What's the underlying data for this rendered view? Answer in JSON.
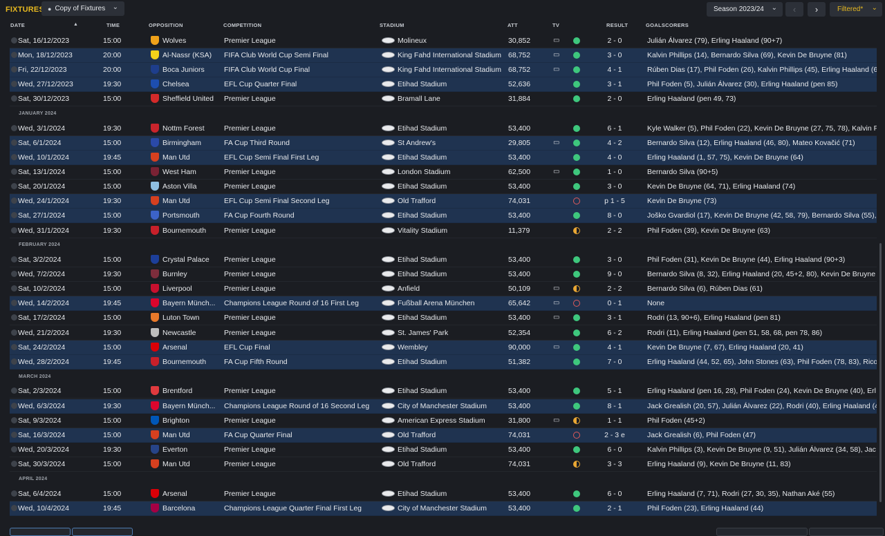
{
  "header": {
    "title": "FIXTURES",
    "view_select": "Copy of Fixtures",
    "season": "Season 2023/24",
    "filter": "Filtered*"
  },
  "columns": {
    "date": "DATE",
    "time": "TIME",
    "opposition": "OPPOSITION",
    "competition": "COMPETITION",
    "stadium": "STADIUM",
    "att": "ATT",
    "tv": "TV",
    "result": "RESULT",
    "goalscorers": "GOALSCORERS"
  },
  "months": {
    "jan": "JANUARY 2024",
    "feb": "FEBRUARY 2024",
    "mar": "MARCH 2024",
    "apr": "APRIL 2024"
  },
  "colors": {
    "accent": "#e6b820",
    "row_highlight": "#1f3350",
    "win": "#3ec77d",
    "draw": "#e9a734",
    "loss": "#e05b5b"
  },
  "fixtures": [
    {
      "date": "Sat, 16/12/2023",
      "time": "15:00",
      "opp": "Wolves",
      "comp": "Premier League",
      "stadium": "Molineux",
      "att": "30,852",
      "tv": true,
      "outcome": "win",
      "result": "2 - 0",
      "scorers": "Julián Álvarez (79), Erling Haaland (90+7)",
      "hl": false,
      "crest": "#f0a21a"
    },
    {
      "date": "Mon, 18/12/2023",
      "time": "20:00",
      "opp": "Al-Nassr (KSA)",
      "comp": "FIFA Club World Cup Semi Final",
      "stadium": "King Fahd International Stadium",
      "att": "68,752",
      "tv": true,
      "outcome": "win",
      "result": "3 - 0",
      "scorers": "Kalvin Phillips (14), Bernardo Silva (69), Kevin De Bruyne (81)",
      "hl": true,
      "crest": "#f2d21a"
    },
    {
      "date": "Fri, 22/12/2023",
      "time": "20:00",
      "opp": "Boca Juniors",
      "comp": "FIFA Club World Cup Final",
      "stadium": "King Fahd International Stadium",
      "att": "68,752",
      "tv": true,
      "outcome": "win",
      "result": "4 - 1",
      "scorers": "Rúben Dias (17), Phil Foden (26), Kalvin Phillips (45), Erling Haaland (6",
      "hl": true,
      "crest": "#1e3e8c"
    },
    {
      "date": "Wed, 27/12/2023",
      "time": "19:30",
      "opp": "Chelsea",
      "comp": "EFL Cup Quarter Final",
      "stadium": "Etihad Stadium",
      "att": "52,636",
      "tv": false,
      "outcome": "win",
      "result": "3 - 1",
      "scorers": "Phil Foden (5), Julián Álvarez (30), Erling Haaland (pen 85)",
      "hl": true,
      "crest": "#1d4eb0"
    },
    {
      "date": "Sat, 30/12/2023",
      "time": "15:00",
      "opp": "Sheffield United",
      "comp": "Premier League",
      "stadium": "Bramall Lane",
      "att": "31,884",
      "tv": false,
      "outcome": "win",
      "result": "2 - 0",
      "scorers": "Erling Haaland (pen 49, 73)",
      "hl": false,
      "crest": "#d32a2a"
    },
    {
      "date": "Wed, 3/1/2024",
      "time": "19:30",
      "opp": "Nottm Forest",
      "comp": "Premier League",
      "stadium": "Etihad Stadium",
      "att": "53,400",
      "tv": false,
      "outcome": "win",
      "result": "6 - 1",
      "scorers": "Kyle Walker (5), Phil Foden (22), Kevin De Bruyne (27, 75, 78), Kalvin P",
      "hl": false,
      "crest": "#c9242c"
    },
    {
      "date": "Sat, 6/1/2024",
      "time": "15:00",
      "opp": "Birmingham",
      "comp": "FA Cup Third Round",
      "stadium": "St Andrew's",
      "att": "29,805",
      "tv": true,
      "outcome": "win",
      "result": "4 - 2",
      "scorers": "Bernardo Silva (12), Erling Haaland (46, 80), Mateo Kovačić (71)",
      "hl": true,
      "crest": "#2a49a8"
    },
    {
      "date": "Wed, 10/1/2024",
      "time": "19:45",
      "opp": "Man Utd",
      "comp": "EFL Cup Semi Final First Leg",
      "stadium": "Etihad Stadium",
      "att": "53,400",
      "tv": false,
      "outcome": "win",
      "result": "4 - 0",
      "scorers": "Erling Haaland (1, 57, 75), Kevin De Bruyne (64)",
      "hl": true,
      "crest": "#d6401f"
    },
    {
      "date": "Sat, 13/1/2024",
      "time": "15:00",
      "opp": "West Ham",
      "comp": "Premier League",
      "stadium": "London Stadium",
      "att": "62,500",
      "tv": true,
      "outcome": "win",
      "result": "1 - 0",
      "scorers": "Bernardo Silva (90+5)",
      "hl": false,
      "crest": "#7a2234"
    },
    {
      "date": "Sat, 20/1/2024",
      "time": "15:00",
      "opp": "Aston Villa",
      "comp": "Premier League",
      "stadium": "Etihad Stadium",
      "att": "53,400",
      "tv": false,
      "outcome": "win",
      "result": "3 - 0",
      "scorers": "Kevin De Bruyne (64, 71), Erling Haaland (74)",
      "hl": false,
      "crest": "#8fbfe2"
    },
    {
      "date": "Wed, 24/1/2024",
      "time": "19:30",
      "opp": "Man Utd",
      "comp": "EFL Cup Semi Final Second Leg",
      "stadium": "Old Trafford",
      "att": "74,031",
      "tv": false,
      "outcome": "loss",
      "result": "p 1 - 5",
      "scorers": "Kevin De Bruyne (73)",
      "hl": true,
      "crest": "#d6401f"
    },
    {
      "date": "Sat, 27/1/2024",
      "time": "15:00",
      "opp": "Portsmouth",
      "comp": "FA Cup Fourth Round",
      "stadium": "Etihad Stadium",
      "att": "53,400",
      "tv": false,
      "outcome": "win",
      "result": "8 - 0",
      "scorers": "Joško Gvardiol (17), Kevin De Bruyne (42, 58, 79), Bernardo Silva (55),",
      "hl": true,
      "crest": "#3c63c8"
    },
    {
      "date": "Wed, 31/1/2024",
      "time": "19:30",
      "opp": "Bournemouth",
      "comp": "Premier League",
      "stadium": "Vitality Stadium",
      "att": "11,379",
      "tv": false,
      "outcome": "draw",
      "result": "2 - 2",
      "scorers": "Phil Foden (39), Kevin De Bruyne (63)",
      "hl": false,
      "crest": "#c8202a"
    },
    {
      "date": "Sat, 3/2/2024",
      "time": "15:00",
      "opp": "Crystal Palace",
      "comp": "Premier League",
      "stadium": "Etihad Stadium",
      "att": "53,400",
      "tv": false,
      "outcome": "win",
      "result": "3 - 0",
      "scorers": "Phil Foden (31), Kevin De Bruyne (44), Erling Haaland (90+3)",
      "hl": false,
      "crest": "#1d3f9a"
    },
    {
      "date": "Wed, 7/2/2024",
      "time": "19:30",
      "opp": "Burnley",
      "comp": "Premier League",
      "stadium": "Etihad Stadium",
      "att": "53,400",
      "tv": false,
      "outcome": "win",
      "result": "9 - 0",
      "scorers": "Bernardo Silva (8, 32), Erling Haaland (20, 45+2, 80), Kevin De Bruyne",
      "hl": false,
      "crest": "#7e2d3c"
    },
    {
      "date": "Sat, 10/2/2024",
      "time": "15:00",
      "opp": "Liverpool",
      "comp": "Premier League",
      "stadium": "Anfield",
      "att": "50,109",
      "tv": true,
      "outcome": "draw",
      "result": "2 - 2",
      "scorers": "Bernardo Silva (6), Rúben Dias (61)",
      "hl": false,
      "crest": "#c8102e"
    },
    {
      "date": "Wed, 14/2/2024",
      "time": "19:45",
      "opp": "Bayern Münch...",
      "comp": "Champions League Round of 16  First Leg",
      "stadium": "Fußball Arena München",
      "att": "65,642",
      "tv": true,
      "outcome": "loss",
      "result": "0 - 1",
      "scorers": "None",
      "hl": true,
      "crest": "#dc052d"
    },
    {
      "date": "Sat, 17/2/2024",
      "time": "15:00",
      "opp": "Luton Town",
      "comp": "Premier League",
      "stadium": "Etihad Stadium",
      "att": "53,400",
      "tv": true,
      "outcome": "win",
      "result": "3 - 1",
      "scorers": "Rodri (13, 90+6), Erling Haaland (pen 81)",
      "hl": false,
      "crest": "#e8792a"
    },
    {
      "date": "Wed, 21/2/2024",
      "time": "19:30",
      "opp": "Newcastle",
      "comp": "Premier League",
      "stadium": "St. James' Park",
      "att": "52,354",
      "tv": false,
      "outcome": "win",
      "result": "6 - 2",
      "scorers": "Rodri (11), Erling Haaland (pen 51, 58, 68, pen 78, 86)",
      "hl": false,
      "crest": "#bdbdbd"
    },
    {
      "date": "Sat, 24/2/2024",
      "time": "15:00",
      "opp": "Arsenal",
      "comp": "EFL Cup Final",
      "stadium": "Wembley",
      "att": "90,000",
      "tv": true,
      "outcome": "win",
      "result": "4 - 1",
      "scorers": "Kevin De Bruyne (7, 67), Erling Haaland (20, 41)",
      "hl": true,
      "crest": "#db0007"
    },
    {
      "date": "Wed, 28/2/2024",
      "time": "19:45",
      "opp": "Bournemouth",
      "comp": "FA Cup Fifth Round",
      "stadium": "Etihad Stadium",
      "att": "51,382",
      "tv": false,
      "outcome": "win",
      "result": "7 - 0",
      "scorers": "Erling Haaland (44, 52, 65), John Stones (63), Phil Foden (78, 83), Rico",
      "hl": true,
      "crest": "#c8202a"
    },
    {
      "date": "Sat, 2/3/2024",
      "time": "15:00",
      "opp": "Brentford",
      "comp": "Premier League",
      "stadium": "Etihad Stadium",
      "att": "53,400",
      "tv": false,
      "outcome": "win",
      "result": "5 - 1",
      "scorers": "Erling Haaland (pen 16, 28), Phil Foden (24), Kevin De Bruyne (40), Erl",
      "hl": false,
      "crest": "#e03a3e"
    },
    {
      "date": "Wed, 6/3/2024",
      "time": "19:30",
      "opp": "Bayern Münch...",
      "comp": "Champions League Round of 16  Second Leg",
      "stadium": "City of Manchester Stadium",
      "att": "53,400",
      "tv": false,
      "outcome": "win",
      "result": "8 - 1",
      "scorers": "Jack Grealish (20, 57), Julián Álvarez (22), Rodri (40), Erling Haaland (4",
      "hl": true,
      "crest": "#dc052d"
    },
    {
      "date": "Sat, 9/3/2024",
      "time": "15:00",
      "opp": "Brighton",
      "comp": "Premier League",
      "stadium": "American Express Stadium",
      "att": "31,800",
      "tv": true,
      "outcome": "draw",
      "result": "1 - 1",
      "scorers": "Phil Foden (45+2)",
      "hl": false,
      "crest": "#0057b8"
    },
    {
      "date": "Sat, 16/3/2024",
      "time": "15:00",
      "opp": "Man Utd",
      "comp": "FA Cup Quarter Final",
      "stadium": "Old Trafford",
      "att": "74,031",
      "tv": false,
      "outcome": "loss",
      "result": "2 - 3 e",
      "scorers": "Jack Grealish (6), Phil Foden (47)",
      "hl": true,
      "crest": "#d6401f"
    },
    {
      "date": "Wed, 20/3/2024",
      "time": "19:30",
      "opp": "Everton",
      "comp": "Premier League",
      "stadium": "Etihad Stadium",
      "att": "53,400",
      "tv": false,
      "outcome": "win",
      "result": "6 - 0",
      "scorers": "Kalvin Phillips (3), Kevin De Bruyne (9, 51), Julián Álvarez (34, 58), Jac",
      "hl": false,
      "crest": "#274488"
    },
    {
      "date": "Sat, 30/3/2024",
      "time": "15:00",
      "opp": "Man Utd",
      "comp": "Premier League",
      "stadium": "Old Trafford",
      "att": "74,031",
      "tv": false,
      "outcome": "draw",
      "result": "3 - 3",
      "scorers": "Erling Haaland (9), Kevin De Bruyne (11, 83)",
      "hl": false,
      "crest": "#d6401f"
    },
    {
      "date": "Sat, 6/4/2024",
      "time": "15:00",
      "opp": "Arsenal",
      "comp": "Premier League",
      "stadium": "Etihad Stadium",
      "att": "53,400",
      "tv": false,
      "outcome": "win",
      "result": "6 - 0",
      "scorers": "Erling Haaland (7, 71), Rodri (27, 30, 35), Nathan Aké (55)",
      "hl": false,
      "crest": "#db0007"
    },
    {
      "date": "Wed, 10/4/2024",
      "time": "19:45",
      "opp": "Barcelona",
      "comp": "Champions League Quarter Final First Leg",
      "stadium": "City of Manchester Stadium",
      "att": "53,400",
      "tv": false,
      "outcome": "win",
      "result": "2 - 1",
      "scorers": "Phil Foden (23), Erling Haaland (44)",
      "hl": true,
      "crest": "#a50044"
    }
  ]
}
